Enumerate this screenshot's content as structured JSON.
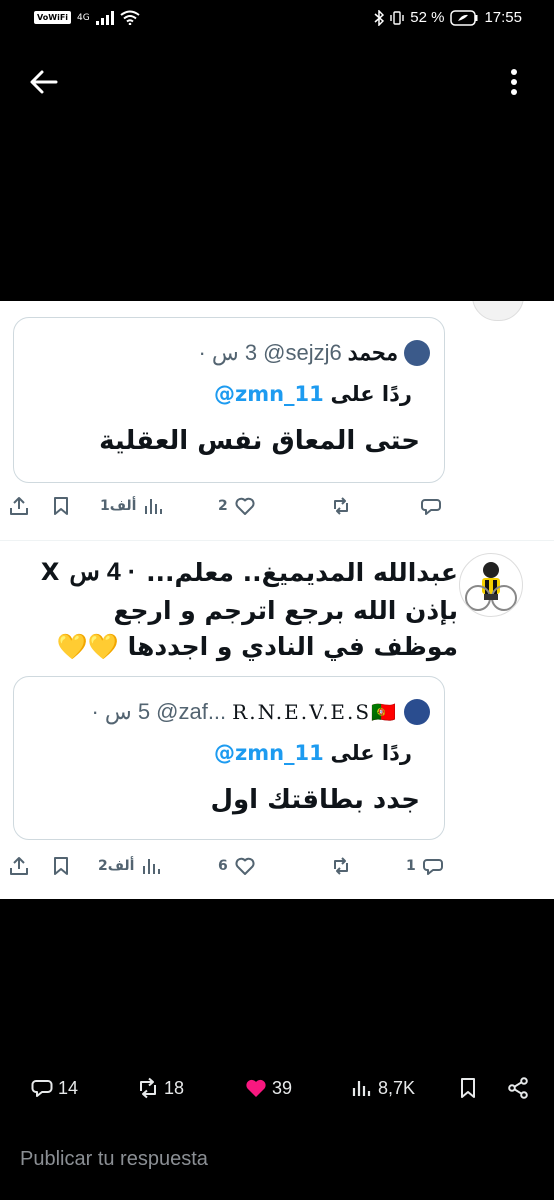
{
  "status_bar": {
    "network_badge": "VoWiFi",
    "network_type": "4G",
    "battery": "52 %",
    "time": "17:55"
  },
  "quote1": {
    "name": "محمد",
    "handle": "@sejzj6",
    "time": "3 س ·",
    "reply_label": "ردًا على",
    "reply_mention": "@zmn_11",
    "text": "حتى المعاق نفس العقلية"
  },
  "actions1": {
    "views": "1ألف",
    "likes": "2",
    "replies": ""
  },
  "tweet": {
    "name": "عبدالله المديميغ.. معلم...",
    "time": "· 4 س",
    "platform_icon": "X",
    "text": "بإذن الله برجع اترجم و ارجع موظف في النادي و اجددها 💛💛"
  },
  "quote2": {
    "name": "R.N.E.V.E.S🇵🇹",
    "handle": "@zaf...",
    "time": "5 س ·",
    "reply_label": "ردًا على",
    "reply_mention": "@zmn_11",
    "text": "جدد بطاقتك اول"
  },
  "actions2": {
    "views": "2ألف",
    "likes": "6",
    "replies": "1"
  },
  "stats": {
    "replies": "14",
    "reposts": "18",
    "likes": "39",
    "views": "8,7K",
    "like_color": "#f91880"
  },
  "reply_input": {
    "placeholder": "Publicar tu respuesta"
  }
}
